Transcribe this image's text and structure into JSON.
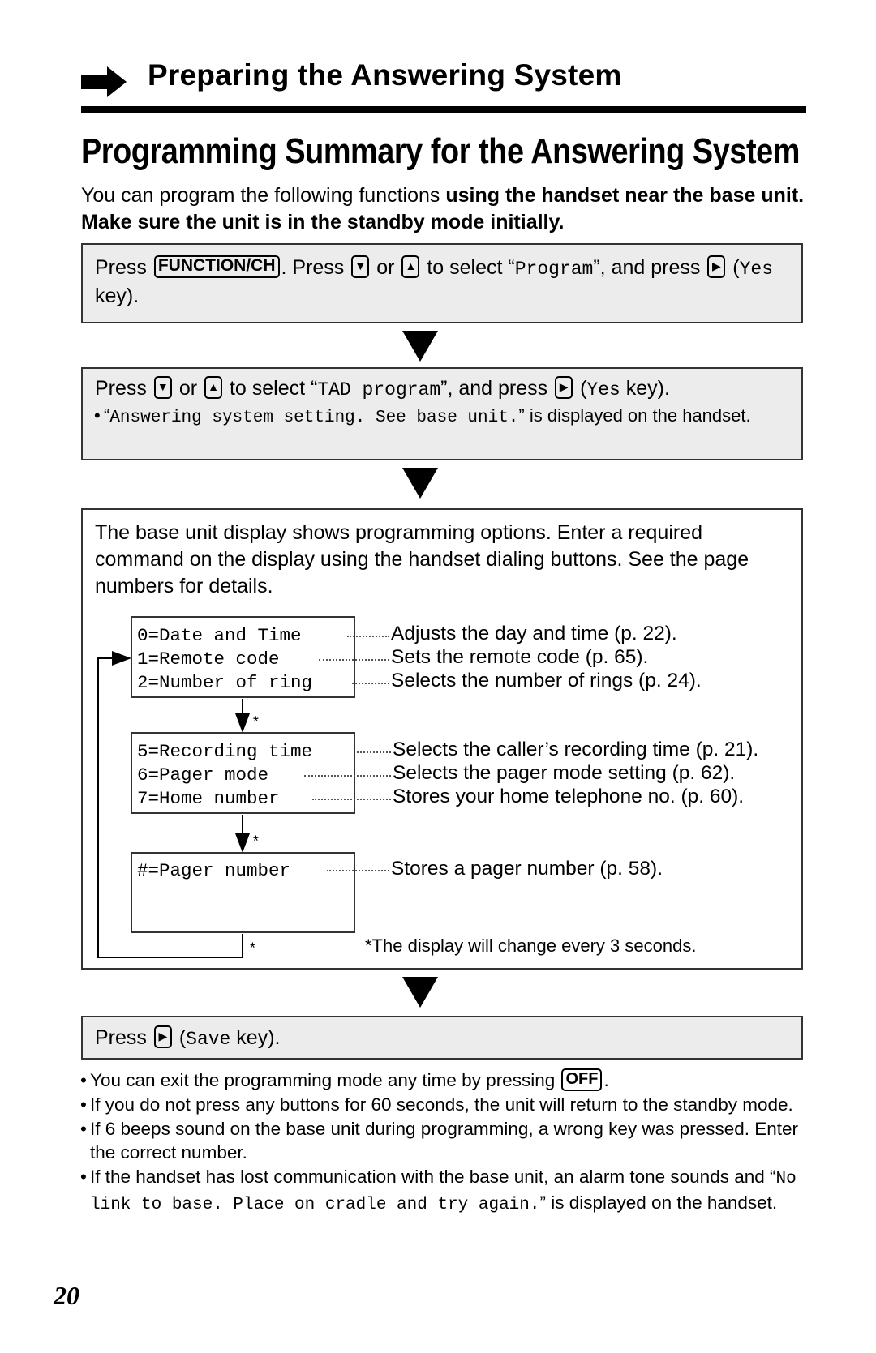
{
  "header": {
    "section_title": "Preparing the Answering System",
    "arrow_icon": "right-arrow-icon"
  },
  "page_title": "Programming Summary for the Answering System",
  "intro": {
    "plain": "You can program the following functions ",
    "bold": "using the handset near the base unit. Make sure the unit is in the standby mode initially."
  },
  "steps": [
    {
      "parts": {
        "press1": "Press",
        "key_function": "FUNCTION/CH",
        "press2": ". Press",
        "key_down": "▼",
        "or": "or",
        "key_up": "▲",
        "to_select": "to select “",
        "display_text": "Program",
        "and_press": "”, and press",
        "key_right": "▶",
        "paren_open": "(",
        "soft_key": "Yes",
        "key_suffix": " key)."
      }
    },
    {
      "parts": {
        "press1": "Press",
        "key_down": "▼",
        "or": "or",
        "key_up": "▲",
        "to_select": "to select “",
        "display_text": "TAD program",
        "and_press": "”, and press",
        "key_right": "▶",
        "paren_open": "(",
        "soft_key": "Yes",
        "key_suffix": " key)."
      },
      "note": {
        "open": "“",
        "display_text": "Answering system setting. See base unit.",
        "rest": "” is displayed on the handset."
      }
    },
    {
      "intro": "The base unit display shows programming options. Enter a required command on the display using the handset dialing buttons. See the page numbers for details.",
      "groups": [
        {
          "options": [
            {
              "code": "0=Date and Time",
              "description": "Adjusts the day and time (p. 22)."
            },
            {
              "code": "1=Remote code",
              "description": "Sets the remote code (p. 65)."
            },
            {
              "code": "2=Number of ring",
              "description": "Selects the number of rings (p. 24)."
            }
          ]
        },
        {
          "options": [
            {
              "code": "5=Recording time",
              "description": "Selects the caller’s recording time (p. 21)."
            },
            {
              "code": "6=Pager mode",
              "description": "Selects the pager mode setting (p. 62)."
            },
            {
              "code": "7=Home number",
              "description": "Stores your home telephone no. (p. 60)."
            }
          ]
        },
        {
          "options": [
            {
              "code": "#=Pager number",
              "description": "Stores a pager number (p. 58)."
            }
          ]
        }
      ],
      "asterisk": "*",
      "footnote": "*The display will change every 3 seconds."
    },
    {
      "parts": {
        "press1": "Press",
        "key_right": "▶",
        "paren_open": "(",
        "soft_key": "Save",
        "key_suffix": " key)."
      }
    }
  ],
  "bullets": [
    {
      "text": "You can exit the programming mode any time by pressing ",
      "key": "OFF",
      "after": "."
    },
    {
      "text": "If you do not press any buttons for 60 seconds, the unit will return to the standby mode."
    },
    {
      "text": "If 6 beeps sound on the base unit during programming, a wrong key was pressed. Enter the correct number."
    },
    {
      "text": "If the handset has lost communication with the base unit, an alarm tone sounds and “",
      "display_text": "No link to base. Place on cradle and try again.",
      "after": "” is displayed on the handset."
    }
  ],
  "page_number": "20"
}
